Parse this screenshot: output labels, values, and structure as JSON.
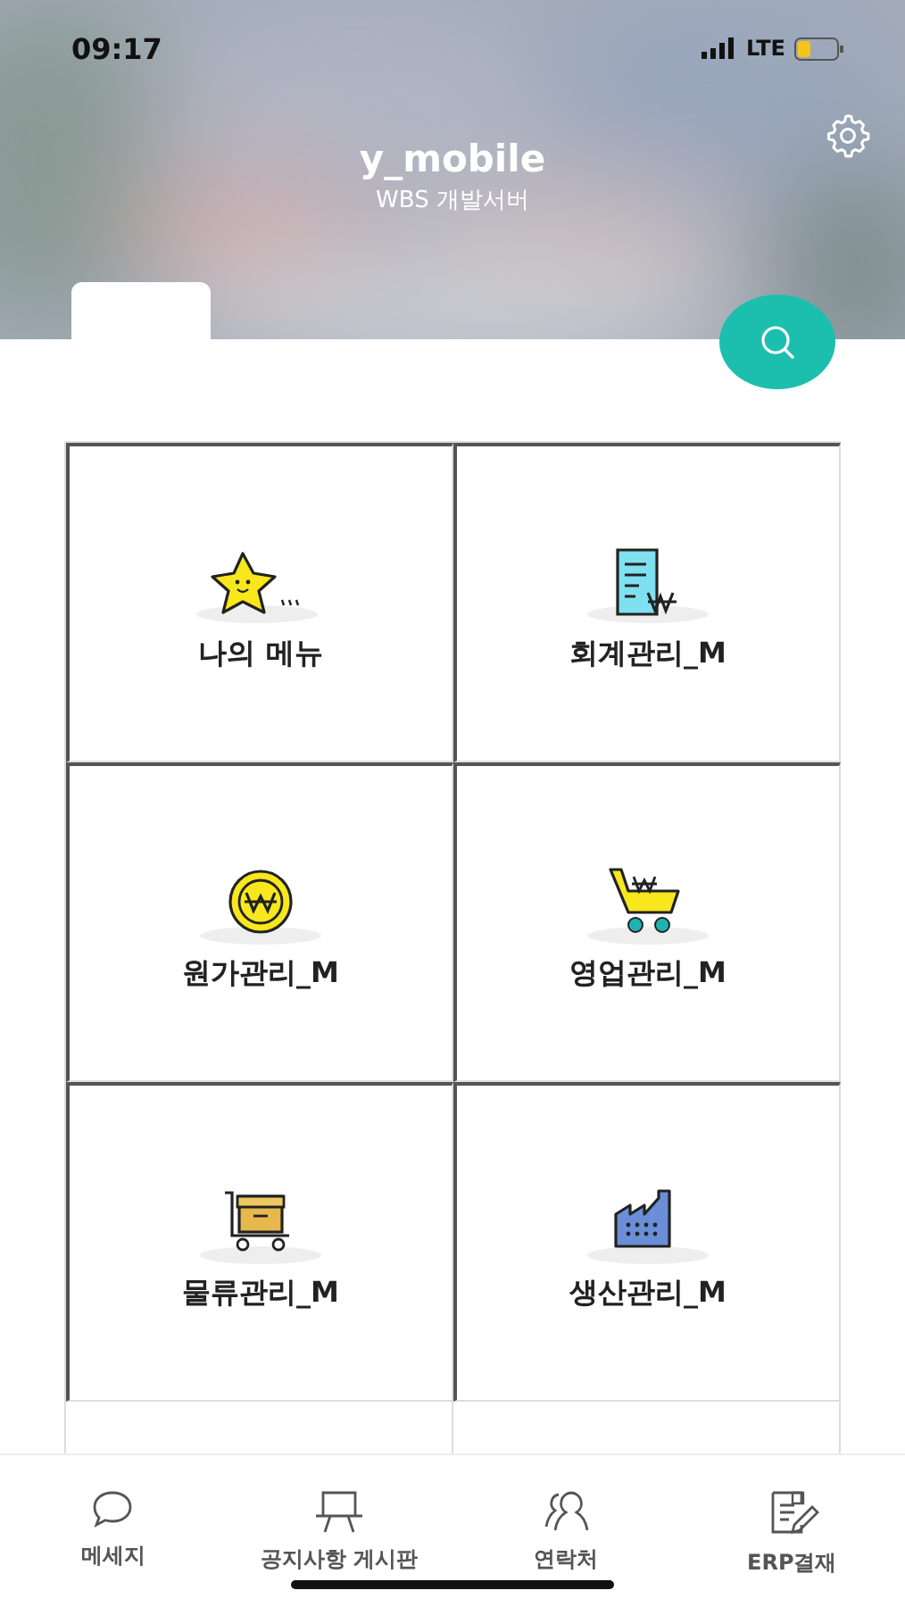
{
  "status_bar": {
    "time": "09:17",
    "network": "LTE"
  },
  "header": {
    "title": "y_mobile",
    "subtitle": "WBS 개발서버"
  },
  "menu": [
    {
      "label": "나의 메뉴"
    },
    {
      "label": "회계관리_M"
    },
    {
      "label": "원가관리_M"
    },
    {
      "label": "영업관리_M"
    },
    {
      "label": "물류관리_M"
    },
    {
      "label": "생산관리_M"
    }
  ],
  "tab_bar": [
    {
      "label": "메세지"
    },
    {
      "label": "공지사항 게시판"
    },
    {
      "label": "연락처"
    },
    {
      "label": "ERP결재"
    }
  ]
}
